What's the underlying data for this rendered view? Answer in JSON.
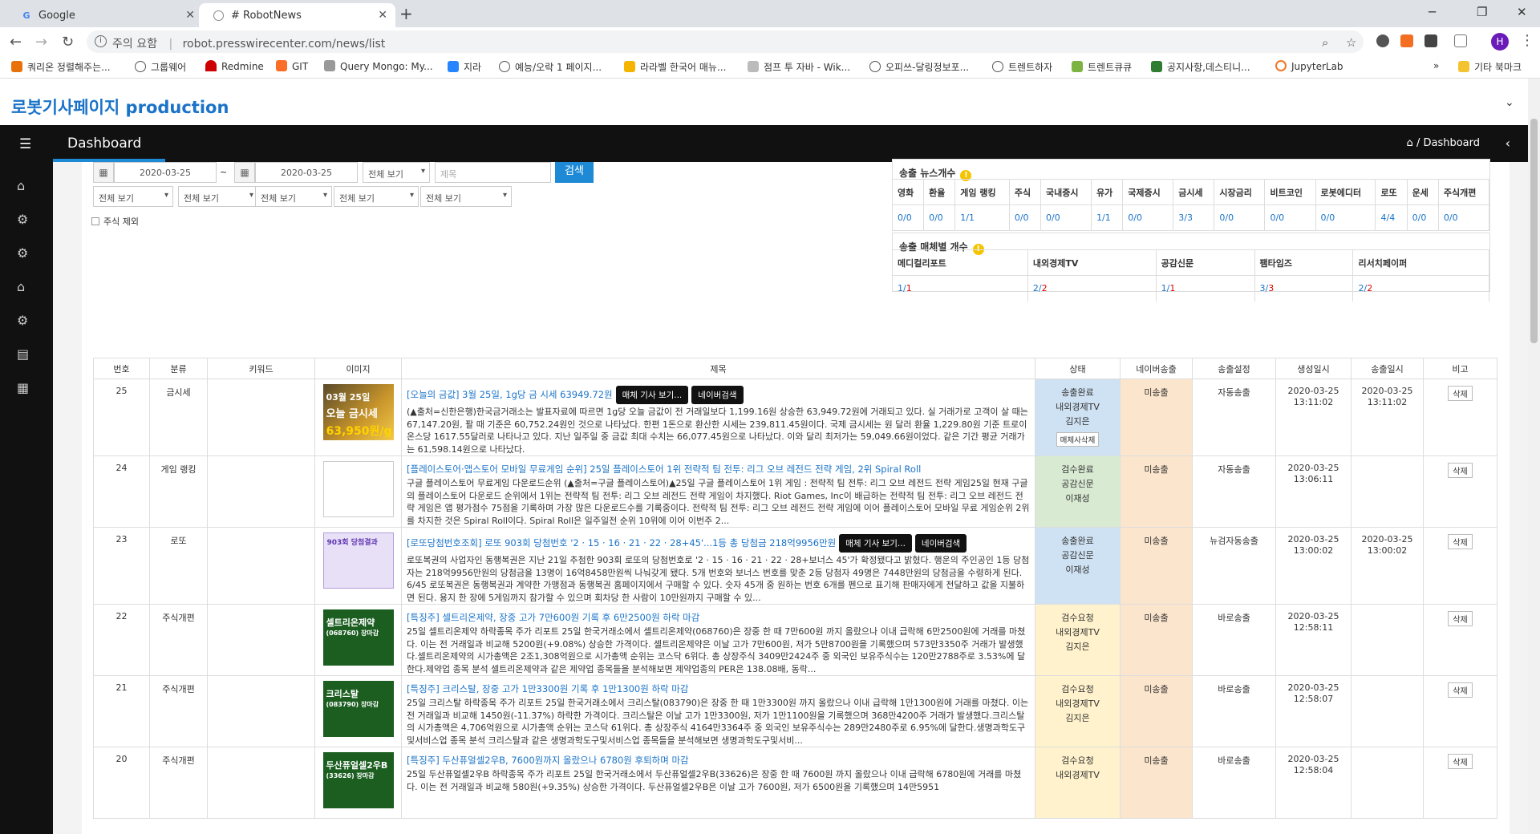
{
  "browser": {
    "tabs": [
      {
        "title": "Google",
        "favicon": "G"
      },
      {
        "title": "# RobotNews",
        "favicon": "globe-icon"
      }
    ],
    "security_label": "주의 요함",
    "url": "robot.presswirecenter.com/news/list",
    "avatar_letter": "H"
  },
  "bookmarks": [
    "쿼리온 정렬해주는...",
    "그룹웨어",
    "Redmine",
    "GIT",
    "Query Mongo: My...",
    "지라",
    "예능/오락 1 페이지...",
    "라라벨 한국어 매뉴...",
    "점프 투 자바 - Wik...",
    "오피쓰-달링정보포...",
    "트렌트하자",
    "트렌트큐큐",
    "공지사항,데스티니...",
    "JupyterLab"
  ],
  "bookmarks_other": "기타 북마크",
  "app": {
    "title": "로봇기사페이지 production",
    "nav_title": "Dashboard",
    "breadcrumb": "Dashboard"
  },
  "filters": {
    "date_from": "2020-03-25",
    "tilde": "~",
    "date_to": "2020-03-25",
    "select_all": "전체 보기",
    "title_placeholder": "제목",
    "search_label": "검색",
    "exclude_stock_label": "주식 제외"
  },
  "stats_news": {
    "title": "송출 뉴스개수",
    "headers": [
      "영화",
      "환율",
      "게임 랭킹",
      "주식",
      "국내증시",
      "유가",
      "국제증시",
      "금시세",
      "시장금리",
      "비트코인",
      "로봇에디터",
      "로또",
      "운세",
      "주식개편"
    ],
    "values": [
      "0/0",
      "0/0",
      "1/1",
      "0/0",
      "0/0",
      "1/1",
      "0/0",
      "3/3",
      "0/0",
      "0/0",
      "0/0",
      "4/4",
      "0/0",
      "0/0"
    ]
  },
  "stats_media": {
    "title": "송출 매체별 개수",
    "headers": [
      "메디컬리포트",
      "내외경제TV",
      "공감신문",
      "팸타임즈",
      "리서치페이퍼"
    ],
    "a": [
      "1/",
      "2/",
      "1/",
      "3/",
      "2/"
    ],
    "b": [
      "1",
      "2",
      "1",
      "3",
      "2"
    ]
  },
  "table": {
    "headers": [
      "번호",
      "분류",
      "키워드",
      "이미지",
      "제목",
      "상태",
      "네이버송출",
      "송출설정",
      "생성일시",
      "송출일시",
      "비고"
    ],
    "popup_view": "매체 기사 보기...",
    "popup_naver": "네이버검색",
    "delete_label": "삭제",
    "delete_media_label": "매체사삭제",
    "rows": [
      {
        "no": "25",
        "category": "금시세",
        "title": "[오늘의 금값] 3월 25일, 1g당 금 시세 63949.72원",
        "body": "(▲출처=신한은행)한국금거래소는 발표자료에 따르면 1g당 오늘 금값이 전 거래일보다 1,199.16원 상승한 63,949.72원에 거래되고 있다. 실 거래가로 고객이 살 때는 67,147.20원, 팔 때 기준은 60,752.24원인 것으로 나타났다. 한편 1돈으로 환산한 시세는 239,811.45원이다. 국제 금시세는 원 달러 환율 1,229.80원 기준 트로이온스당 1617.55달러로 나타나고 있다. 지난 일주일 중 금값 최대 수치는 66,077.45원으로 나타났다. 이와 달리 최저가는 59,049.66원이었다. 같은 기간 평균 거래가는 61,598.14원으로 나타났다.",
        "status": [
          "송출완료",
          "내외경제TV",
          "김지은"
        ],
        "naver": "미송출",
        "setting": "자동송출",
        "created": [
          "2020-03-25",
          "13:11:02"
        ],
        "sent": [
          "2020-03-25",
          "13:11:02"
        ],
        "thumb": {
          "l1": "03월 25일",
          "l2": "오늘 금시세",
          "l3": "63,950원/g"
        }
      },
      {
        "no": "24",
        "category": "게임 랭킹",
        "title": "[플레이스토어·앱스토어 모바일 무료게임 순위] 25일 플레이스토어 1위 전략적 팀 전투: 리그 오브 레전드 전략 게임, 2위 Spiral Roll",
        "body": "구글 플레이스토어 무료게임 다운로드순위 (▲출처=구글 플레이스토어)▲25일 구글 플레이스토어 1위 게임 : 전략적 팀 전투: 리그 오브 레전드 전략 게임25일 현재 구글의 플레이스토어 다운로드 순위에서 1위는 전략적 팀 전투: 리그 오브 레전드 전략 게임이 차지했다. Riot Games, Inc이 배급하는 전략적 팀 전투: 리그 오브 레전드 전략 게임은 앱 평가점수 75점을 기록하며 가장 많은 다운로드수를 기록중이다. 전략적 팀 전투: 리그 오브 레전드 전략 게임에 이어 플레이스토어 모바일 무료 게임순위 2위를 차지한 것은 Spiral Roll이다. Spiral Roll은 일주일전 순위 10위에 이어 이번주 2...",
        "status": [
          "검수완료",
          "공감신문",
          "이재성"
        ],
        "naver": "미송출",
        "setting": "자동송출",
        "created": [
          "2020-03-25",
          "13:06:11"
        ],
        "sent": [
          "",
          ""
        ],
        "thumb": {
          "l1": "",
          "l2": "",
          "l3": ""
        }
      },
      {
        "no": "23",
        "category": "로또",
        "title": "[로또당첨번호조회] 로또 903회 당첨번호 '2 · 15 · 16 · 21 · 22 · 28+45'...1등 총 당첨금 218억9956만원",
        "body": "로또복권의 사업자인 동행복권은 지난 21일 추첨한 903회 로또의 당첨번호로 '2 · 15 · 16 · 21 · 22 · 28+보너스 45'가 확정됐다고 밝혔다. 행운의 주인공인 1등 당첨자는 218억9956만원의 당첨금을 13명이 16억8458만원씩 나눠갖게 됐다. 5개 번호와 보너스 번호를 맞춘 2등 당첨자 49명은 7448만원의 당첨금을 수령하게 된다. 6/45 로또복권은 동행복권과 계약한 가맹점과 동행복권 홈페이지에서 구매할 수 있다. 숫자 45개 중 원하는 번호 6개를 펜으로 표기해 판매자에게 전달하고 값을 지불하면 된다. 용지 한 장에 5게임까지 참가할 수 있으며 회차당 한 사람이 10만원까지 구매할 수 있...",
        "status": [
          "송출완료",
          "공감신문",
          "이재성"
        ],
        "naver": "미송출",
        "setting": "뉴검자동송출",
        "created": [
          "2020-03-25",
          "13:00:02"
        ],
        "sent": [
          "2020-03-25",
          "13:00:02"
        ],
        "thumb": {
          "l1": "903회 당첨결과",
          "l2": "",
          "l3": ""
        }
      },
      {
        "no": "22",
        "category": "주식개편",
        "title": "[특징주] 셀트리온제약, 장중 고가 7만600원 기록 후 6만2500원 하락 마감",
        "body": "25일 셀트리온제약 하락종목 주가 리포트 25일 한국거래소에서 셀트리온제약(068760)은 장중 한 때 7만600원 까지 올랐으나 이내 급락해 6만2500원에 거래를 마쳤다. 이는 전 거래일과 비교해 5200원(+9.08%) 상승한 가격이다. 셀트리온제약은 이날 고가 7만600원, 저가 5만8700원을 기록했으며 573만3350주 거래가 발생했다.셀트리온제약의 시가총액은 2조1,308억원으로 시가총액 순위는 코스닥 6위다. 총 상장주식 3409만2424주 중 외국인 보유주식수는 120만2788주로 3.53%에 달한다.제약업 종목 분석 셀트리온제약과 같은 제약업 종목들을 분석해보면 제약업종의 PER은 138.08배, 동락...",
        "status": [
          "검수요청",
          "내외경제TV",
          "김지은"
        ],
        "naver": "미송출",
        "setting": "바로송출",
        "created": [
          "2020-03-25",
          "12:58:11"
        ],
        "sent": [
          "",
          ""
        ],
        "thumb": {
          "l1": "셀트리온제약",
          "l2": "(068760) 장마감",
          "l3": ""
        }
      },
      {
        "no": "21",
        "category": "주식개편",
        "title": "[특징주] 크리스탈, 장중 고가 1만3300원 기록 후 1만1300원 하락 마감",
        "body": "25일 크리스탈 하락종목 주가 리포트 25일 한국거래소에서 크리스탈(083790)은 장중 한 때 1만3300원 까지 올랐으나 이내 급락해 1만1300원에 거래를 마쳤다. 이는 전 거래일과 비교해 1450원(-11.37%) 하락한 가격이다. 크리스탈은 이날 고가 1만3300원, 저가 1만1100원을 기록했으며 368만4200주 거래가 발생했다.크리스탈의 시가총액은 4,706억원으로 시가총액 순위는 코스닥 61위다. 총 상장주식 4164만3364주 중 외국인 보유주식수는 289만2480주로 6.95%에 달한다.생명과학도구및서비스업 종목 분석 크리스탈과 같은 생명과학도구및서비스업 종목들을 분석해보면 생명과학도구및서비...",
        "status": [
          "검수요청",
          "내외경제TV",
          "김지은"
        ],
        "naver": "미송출",
        "setting": "바로송출",
        "created": [
          "2020-03-25",
          "12:58:07"
        ],
        "sent": [
          "",
          ""
        ],
        "thumb": {
          "l1": "크리스탈",
          "l2": "(083790) 장마감",
          "l3": ""
        }
      },
      {
        "no": "20",
        "category": "주식개편",
        "title": "[특징주] 두산퓨얼셀2우B, 7600원까지 올랐으나 6780원 후퇴하며 마감",
        "body": "25일 두산퓨얼셀2우B 하락종목 주가 리포트 25일 한국거래소에서 두산퓨얼셀2우B(33626)은 장중 한 때 7600원 까지 올랐으나 이내 급락해 6780원에 거래를 마쳤다. 이는 전 거래일과 비교해 580원(+9.35%) 상승한 가격이다. 두산퓨얼셀2우B은 이날 고가 7600원, 저가 6500원을 기록했으며 14만5951",
        "status": [
          "검수요청",
          "내외경제TV",
          ""
        ],
        "naver": "미송출",
        "setting": "바로송출",
        "created": [
          "2020-03-25",
          "12:58:04"
        ],
        "sent": [
          "",
          ""
        ],
        "thumb": {
          "l1": "두산퓨얼셀2우B",
          "l2": "(33626) 장마감",
          "l3": ""
        }
      }
    ]
  }
}
